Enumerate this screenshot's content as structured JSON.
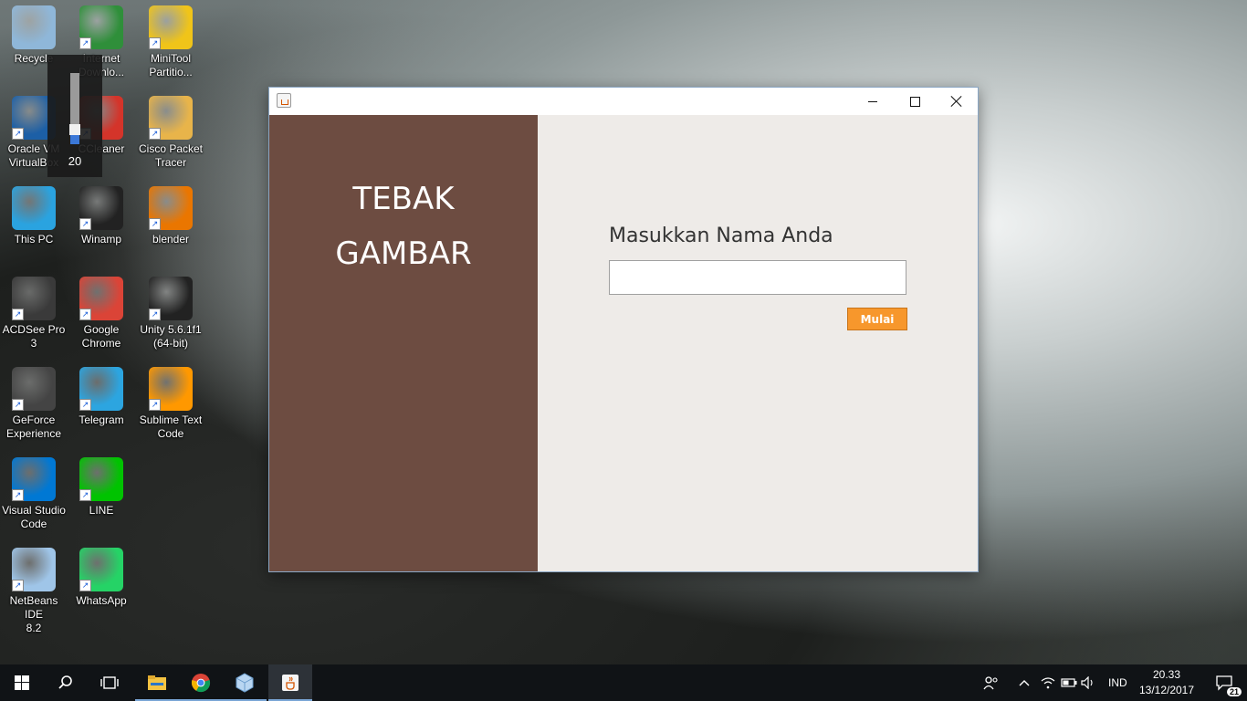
{
  "desktop": {
    "icons": [
      {
        "label": "Recycle",
        "icon": "recycle-bin-icon",
        "color": "#8fb7d9"
      },
      {
        "label": "Internet\nDownlo...",
        "icon": "internet-download-manager-icon",
        "color": "#2f8f3a"
      },
      {
        "label": "MiniTool\nPartitio...",
        "icon": "minitool-partition-icon",
        "color": "#f0c419"
      },
      {
        "label": "Oracle VM\nVirtualBox",
        "icon": "virtualbox-icon",
        "color": "#1c5fa6"
      },
      {
        "label": "CCleaner",
        "icon": "ccleaner-icon",
        "color": "#d4342a"
      },
      {
        "label": "Cisco Packet\nTracer",
        "icon": "cisco-packet-tracer-icon",
        "color": "#e8b44a"
      },
      {
        "label": "This PC",
        "icon": "this-pc-icon",
        "color": "#2aa3e0"
      },
      {
        "label": "Winamp",
        "icon": "winamp-icon",
        "color": "#222222"
      },
      {
        "label": "blender",
        "icon": "blender-icon",
        "color": "#ea7600"
      },
      {
        "label": "ACDSee Pro\n3",
        "icon": "acdsee-icon",
        "color": "#3a3a3a"
      },
      {
        "label": "Google\nChrome",
        "icon": "chrome-icon",
        "color": "#db4437"
      },
      {
        "label": "Unity 5.6.1f1\n(64-bit)",
        "icon": "unity-icon",
        "color": "#222222"
      },
      {
        "label": "GeForce\nExperience",
        "icon": "geforce-icon",
        "color": "#444444"
      },
      {
        "label": "Telegram",
        "icon": "telegram-icon",
        "color": "#2ca5e0"
      },
      {
        "label": "Sublime Text\nCode",
        "icon": "sublime-text-icon",
        "color": "#ff9800"
      },
      {
        "label": "Visual Studio\nCode",
        "icon": "vscode-icon",
        "color": "#0078d4"
      },
      {
        "label": "LINE",
        "icon": "line-icon",
        "color": "#00c300"
      },
      {
        "label": "NetBeans IDE\n8.2",
        "icon": "netbeans-icon",
        "color": "#9fc5e8"
      },
      {
        "label": "WhatsApp",
        "icon": "whatsapp-icon",
        "color": "#25d366"
      }
    ]
  },
  "volume": {
    "value": "20",
    "level": 0.2
  },
  "window": {
    "title_icon": "java-icon",
    "left_panel": {
      "title_line1": "TEBAK",
      "title_line2": "GAMBAR",
      "bg": "#6d4c41"
    },
    "form": {
      "label": "Masukkan Nama Anda",
      "input_value": "",
      "button_label": "Mulai",
      "button_color": "#f7972c"
    }
  },
  "taskbar": {
    "apps": [
      "start-icon",
      "search-icon",
      "task-view-icon",
      "file-explorer-icon",
      "chrome-icon",
      "netbeans-icon",
      "java-icon"
    ],
    "tray": {
      "language": "IND",
      "time": "20.33",
      "date": "13/12/2017",
      "notifications": "21"
    }
  }
}
